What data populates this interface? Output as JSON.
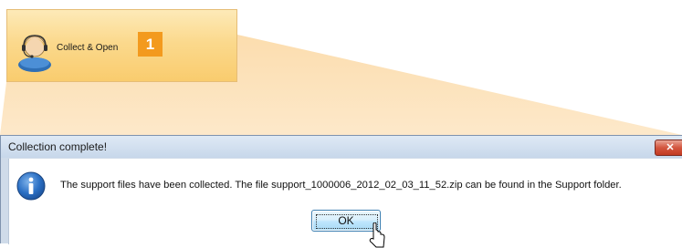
{
  "callout": {
    "button_label": "Collect & Open",
    "step_number": "1",
    "avatar_icon": "support-agent-icon",
    "accent_color": "#f39a1e"
  },
  "dialog": {
    "title": "Collection complete!",
    "icon": "info-icon",
    "message": "The support files have been collected. The file support_1000006_2012_02_03_11_52.zip can be found in the Support folder.",
    "ok_label": "OK",
    "close_icon": "close-icon"
  }
}
